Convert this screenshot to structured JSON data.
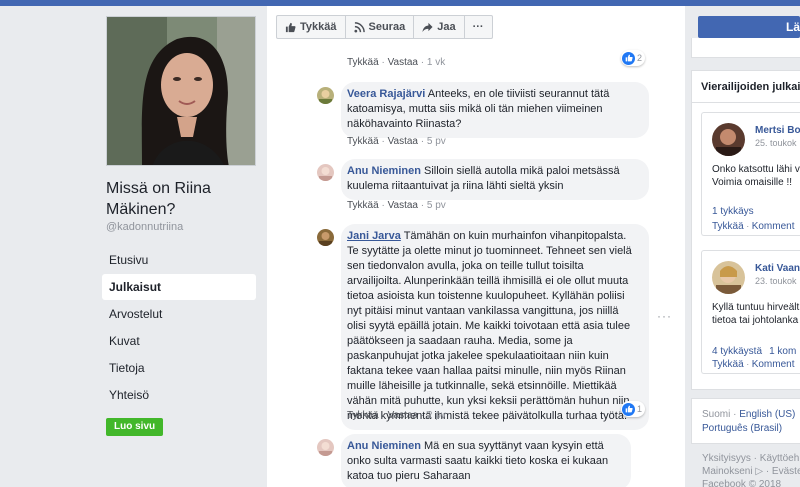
{
  "page": {
    "name": "Missä on Riina Mäkinen?",
    "handle": "@kadonnutriina",
    "create_page_button": "Luo sivu"
  },
  "nav": [
    {
      "label": "Etusivu",
      "active": false
    },
    {
      "label": "Julkaisut",
      "active": true
    },
    {
      "label": "Arvostelut",
      "active": false
    },
    {
      "label": "Kuvat",
      "active": false
    },
    {
      "label": "Tietoja",
      "active": false
    },
    {
      "label": "Yhteisö",
      "active": false
    }
  ],
  "actions": {
    "like": "Tykkää",
    "follow": "Seuraa",
    "share": "Jaa",
    "more": "···"
  },
  "comments": [
    {
      "author": "",
      "text": "",
      "like": "Tykkää",
      "reply": "Vastaa",
      "time": "1 vk",
      "reactions": "2"
    },
    {
      "author": "Veera Rajajärvi",
      "text": "Anteeks, en ole tiiviisti seurannut tätä katoamisya, mutta siis mikä oli tän miehen viimeinen näköhavainto Riinasta?",
      "like": "Tykkää",
      "reply": "Vastaa",
      "time": "5 pv"
    },
    {
      "author": "Anu Nieminen",
      "text": "Silloin siellä autolla mikä paloi metsässä kuulema riitaantuivat ja riina lähti sieltä yksin",
      "like": "Tykkää",
      "reply": "Vastaa",
      "time": "5 pv"
    },
    {
      "author": "Jani Jarva",
      "text": "Tämähän on kuin murhainfon vihanpitopalsta. Te syytätte ja olette minut jo tuominneet. Tehneet sen vielä sen tiedonvalon avulla, joka on teille tullut toisilta arvailijoilta. Alunperinkään teillä ihmisillä ei ole ollut muuta tietoa asioista kun toistenne kuulopuheet. Kyllähän poliisi nyt pitäisi minut vantaan vankilassa vangittuna, jos niillä olisi syytä epäillä jotain. Me kaikki toivotaan että asia tulee päätökseen ja saadaan rauha. Media, some ja paskanpuhujat jotka jakelee spekulaatioitaan niin kuin faktana tekee vaan hallaa paitsi minulle, niin myös Riinan muille läheisille ja tutkinnalle, sekä etsinnöille. Miettikää vähän mitä puhutte, kun yksi keksii perättömän huhun niin monta kymmentä ihmistä tekee päivätolkulla turhaa työtä.",
      "like": "Tykkää",
      "reply": "Vastaa",
      "time": "2 pv",
      "reactions": "1"
    },
    {
      "author": "Anu Nieminen",
      "text": "Mä en sua syyttänyt vaan kysyin että onko sulta varmasti saatu kaikki tieto koska ei kukaan katoa tuo pieru Saharaan"
    }
  ],
  "right": {
    "like_page_button": "Lä",
    "visitor_posts_title": "Vierailijoiden julkaisu",
    "visitor_posts": [
      {
        "name": "Mertsi Bo",
        "date": "25. toukok",
        "text1": "Onko katsottu lähi v",
        "text2": "Voimia omaisille !!",
        "stat": "1 tykkäys",
        "stat2": "",
        "like": "Tykkää",
        "comment": "Komment"
      },
      {
        "name": "Kati Vaan",
        "date": "23. toukok",
        "text1": "Kyllä tuntuu hirveält",
        "text2": "tietoa tai johtolanka",
        "stat": "4 tykkäystä",
        "stat2": "1 kom",
        "like": "Tykkää",
        "comment": "Komment"
      }
    ],
    "lang_current": "Suomi",
    "lang_link": "English (US)",
    "lang_link2": "Português (Brasil)",
    "footer_line1": "Yksityisyys · Käyttöeh",
    "footer_line2": "Mainokseni ▷ · Eväste",
    "footer_line3": "Facebook © 2018"
  },
  "colors": {
    "fb_blue": "#4267b2",
    "link": "#385898",
    "green": "#42b72a",
    "bubble": "#f2f3f5"
  }
}
